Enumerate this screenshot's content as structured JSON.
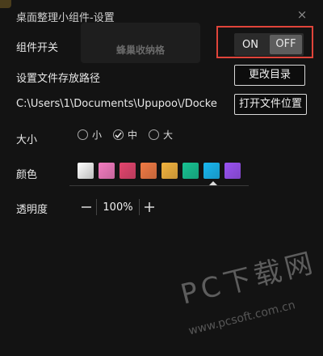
{
  "window": {
    "title": "桌面整理小组件-设置",
    "close_icon": "×"
  },
  "background_widget": {
    "label": "蜂巢收纳格"
  },
  "widget_toggle": {
    "label": "组件开关",
    "on_label": "ON",
    "off_label": "OFF",
    "selected": "OFF"
  },
  "storage_path": {
    "label": "设置文件存放路径",
    "change_button": "更改目录",
    "path_value": "C:\\Users\\1\\Documents\\Upupoo\\/Docke",
    "open_button": "打开文件位置"
  },
  "size": {
    "label": "大小",
    "options": [
      "小",
      "中",
      "大"
    ],
    "selected": "中"
  },
  "color": {
    "label": "颜色",
    "swatches": [
      "#e6e6e6",
      "#f27bbf",
      "#e2456e",
      "#f07a44",
      "#f2b33e",
      "#17c292",
      "#19b7f0",
      "#9a52f2"
    ],
    "selected": "#19b7f0"
  },
  "opacity": {
    "label": "透明度",
    "value": "100%"
  },
  "watermark": {
    "main": "PC下载网",
    "url": "www.pcsoft.com.cn"
  }
}
